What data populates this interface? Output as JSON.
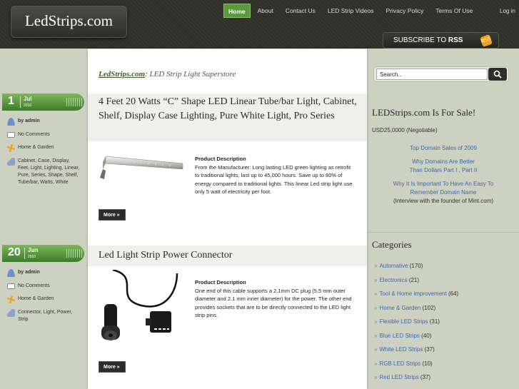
{
  "header": {
    "site_title": "LedStrips.com",
    "nav": [
      "Home",
      "About",
      "Contact Us",
      "LED Strip Videos",
      "Privacy Policy",
      "Terms Of Use"
    ],
    "login": "Log in",
    "rss_prefix": "SUBSCRIBE TO ",
    "rss_bold": "RSS"
  },
  "tagline": {
    "site": "LedStrips.com",
    "text": ": LED Strip Light Superstore"
  },
  "posts": [
    {
      "day": "1",
      "month": "Jul",
      "year": "2010",
      "author": "by admin",
      "comments": "No Comments",
      "category": "Home & Garden",
      "tags": "Cabinet, Case, Display, Feet, Light, Lighting, Linear, Pure, Series, Shape, Shelf, Tube/bar, Watts, White",
      "title": "4 Feet 20 Watts “C” Shape LED Linear Tube/bar Light, Cabinet, Shelf, Display Case Lighting, Pure White Light, Pro Series",
      "desc_label": "Product Description",
      "desc": "From the Manufacturer: Long lasting LED green lighting as retrofit to traditional lights, last up to 45,000 hours. Save up to 80% of energy compared to traditional lights. This linear Led strip light use only 5 watt of electricity per foot.",
      "more": "More »"
    },
    {
      "day": "20",
      "month": "Jun",
      "year": "2010",
      "author": "by admin",
      "comments": "No Comments",
      "category": "Home & Garden",
      "tags": "Connector, Light, Power, Strip",
      "title": "Led Light Strip Power Connector",
      "desc_label": "Product Description",
      "desc": "One end of this cable supports a 2.1mm DC plug (5.5 mm outer diameter and 2.1 mm inner diameter) for the power. The other end provides sockets that are to be directly connected to the LED light strip pins.",
      "more": "More »"
    }
  ],
  "sidebar": {
    "search_value": "Search...",
    "sale_title": "LEDStrips.com Is For Sale!",
    "sale_price": "USD25,0000 (Negotiable)",
    "sale_link1": "Top Domain Sales of 2009",
    "sale_link2": "Why Domains Are Better Than Dollars Part I , Part II",
    "sale_link3": "Why It Is Important To Have An Easy To Remember Domain Name",
    "sale_link3_suffix": "(Interview with the founder of Mint.com)",
    "categories_title": "Categories",
    "categories": [
      {
        "name": "Automative",
        "count": "(170)"
      },
      {
        "name": "Electronics",
        "count": "(21)"
      },
      {
        "name": "Tool & Home improvement",
        "count": "(64)"
      },
      {
        "name": "Home & Garden",
        "count": "(102)"
      },
      {
        "name": "Flexible LED Strips",
        "count": "(31)"
      },
      {
        "name": "Blue LED Strips",
        "count": "(40)"
      },
      {
        "name": "White LED Strips",
        "count": "(37)"
      },
      {
        "name": "RGB LED Strips",
        "count": "(10)"
      },
      {
        "name": "Red LED Strips",
        "count": "(37)"
      }
    ]
  },
  "colors": {
    "accent_green": "#5a9a3c",
    "link_blue": "#3a6aa8",
    "header_dark": "#2f3129"
  }
}
